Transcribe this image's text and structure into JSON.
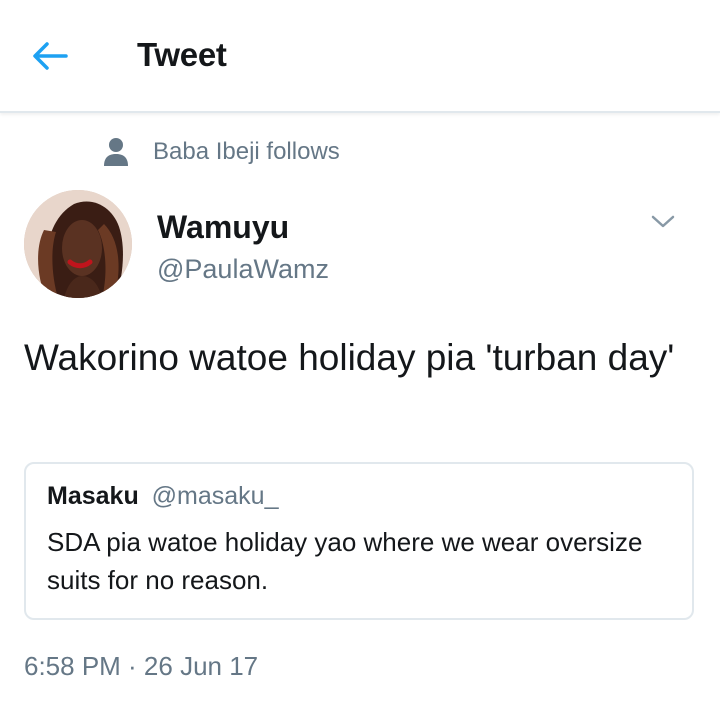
{
  "header": {
    "title": "Tweet",
    "back_icon": "arrow-left-icon",
    "accent_color": "#1da1f2"
  },
  "social_context": {
    "icon": "person-icon",
    "text": "Baba Ibeji follows"
  },
  "author": {
    "display_name": "Wamuyu",
    "handle": "@PaulaWamz",
    "menu_icon": "chevron-down-icon"
  },
  "tweet": {
    "text": "Wakorino watoe holiday pia 'turban day'"
  },
  "quoted_tweet": {
    "display_name": "Masaku",
    "handle": "@masaku_",
    "text": "SDA pia watoe holiday yao where we wear oversize suits for no reason."
  },
  "meta": {
    "timestamp": "6:58 PM · 26 Jun 17"
  }
}
